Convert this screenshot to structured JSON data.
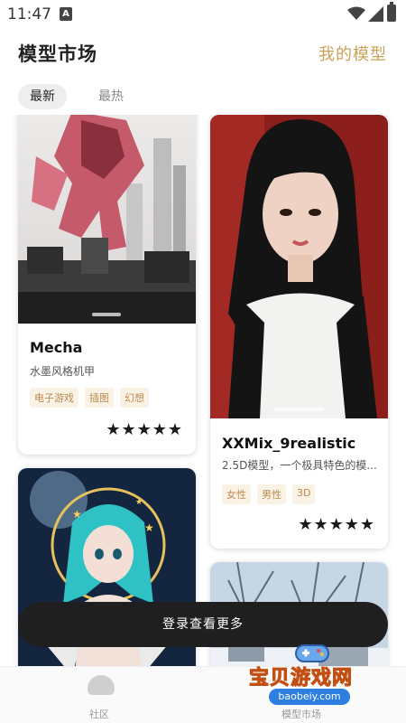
{
  "status": {
    "time": "11:47",
    "notif": "A"
  },
  "header": {
    "title": "模型市场",
    "my_models": "我的模型"
  },
  "tabs": [
    {
      "label": "最新"
    },
    {
      "label": "最热"
    }
  ],
  "cards": [
    {
      "name": "Mecha",
      "desc": "水墨风格机甲",
      "tags": [
        "电子游戏",
        "插图",
        "幻想"
      ],
      "rating": "★★★★★",
      "rating_value": 5
    },
    {
      "name": "XXMix_9realistic",
      "desc": "2.5D模型，一个极具特色的模...",
      "tags": [
        "女性",
        "男性",
        "3D"
      ],
      "rating": "★★★★★",
      "rating_value": 5
    }
  ],
  "login_bar": {
    "label": "登录查看更多"
  },
  "bottom_nav": [
    {
      "label": "社区"
    },
    {
      "label": "模型市场"
    }
  ],
  "watermark": {
    "text": "宝贝游戏网",
    "url": "baobeiy.com"
  }
}
